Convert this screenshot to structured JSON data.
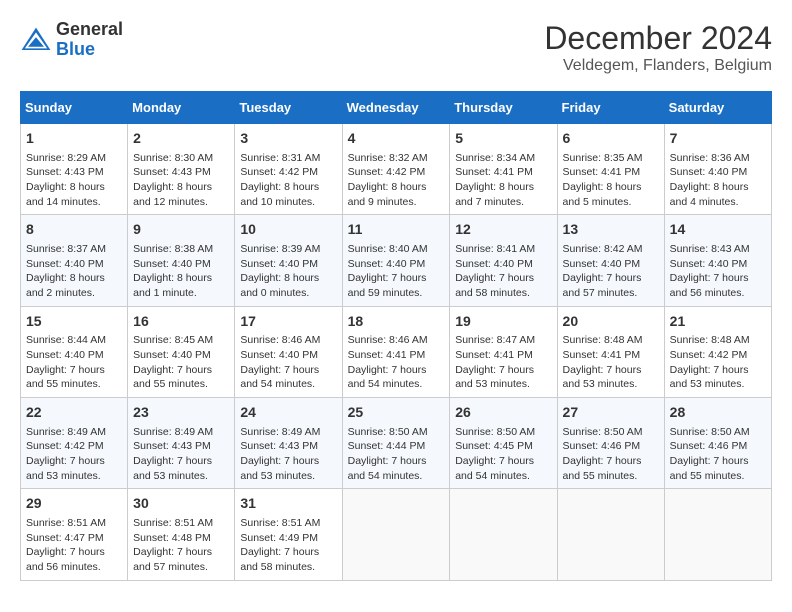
{
  "logo": {
    "text_general": "General",
    "text_blue": "Blue"
  },
  "title": "December 2024",
  "subtitle": "Veldegem, Flanders, Belgium",
  "days_of_week": [
    "Sunday",
    "Monday",
    "Tuesday",
    "Wednesday",
    "Thursday",
    "Friday",
    "Saturday"
  ],
  "weeks": [
    [
      {
        "day": "1",
        "info": "Sunrise: 8:29 AM\nSunset: 4:43 PM\nDaylight: 8 hours\nand 14 minutes."
      },
      {
        "day": "2",
        "info": "Sunrise: 8:30 AM\nSunset: 4:43 PM\nDaylight: 8 hours\nand 12 minutes."
      },
      {
        "day": "3",
        "info": "Sunrise: 8:31 AM\nSunset: 4:42 PM\nDaylight: 8 hours\nand 10 minutes."
      },
      {
        "day": "4",
        "info": "Sunrise: 8:32 AM\nSunset: 4:42 PM\nDaylight: 8 hours\nand 9 minutes."
      },
      {
        "day": "5",
        "info": "Sunrise: 8:34 AM\nSunset: 4:41 PM\nDaylight: 8 hours\nand 7 minutes."
      },
      {
        "day": "6",
        "info": "Sunrise: 8:35 AM\nSunset: 4:41 PM\nDaylight: 8 hours\nand 5 minutes."
      },
      {
        "day": "7",
        "info": "Sunrise: 8:36 AM\nSunset: 4:40 PM\nDaylight: 8 hours\nand 4 minutes."
      }
    ],
    [
      {
        "day": "8",
        "info": "Sunrise: 8:37 AM\nSunset: 4:40 PM\nDaylight: 8 hours\nand 2 minutes."
      },
      {
        "day": "9",
        "info": "Sunrise: 8:38 AM\nSunset: 4:40 PM\nDaylight: 8 hours\nand 1 minute."
      },
      {
        "day": "10",
        "info": "Sunrise: 8:39 AM\nSunset: 4:40 PM\nDaylight: 8 hours\nand 0 minutes."
      },
      {
        "day": "11",
        "info": "Sunrise: 8:40 AM\nSunset: 4:40 PM\nDaylight: 7 hours\nand 59 minutes."
      },
      {
        "day": "12",
        "info": "Sunrise: 8:41 AM\nSunset: 4:40 PM\nDaylight: 7 hours\nand 58 minutes."
      },
      {
        "day": "13",
        "info": "Sunrise: 8:42 AM\nSunset: 4:40 PM\nDaylight: 7 hours\nand 57 minutes."
      },
      {
        "day": "14",
        "info": "Sunrise: 8:43 AM\nSunset: 4:40 PM\nDaylight: 7 hours\nand 56 minutes."
      }
    ],
    [
      {
        "day": "15",
        "info": "Sunrise: 8:44 AM\nSunset: 4:40 PM\nDaylight: 7 hours\nand 55 minutes."
      },
      {
        "day": "16",
        "info": "Sunrise: 8:45 AM\nSunset: 4:40 PM\nDaylight: 7 hours\nand 55 minutes."
      },
      {
        "day": "17",
        "info": "Sunrise: 8:46 AM\nSunset: 4:40 PM\nDaylight: 7 hours\nand 54 minutes."
      },
      {
        "day": "18",
        "info": "Sunrise: 8:46 AM\nSunset: 4:41 PM\nDaylight: 7 hours\nand 54 minutes."
      },
      {
        "day": "19",
        "info": "Sunrise: 8:47 AM\nSunset: 4:41 PM\nDaylight: 7 hours\nand 53 minutes."
      },
      {
        "day": "20",
        "info": "Sunrise: 8:48 AM\nSunset: 4:41 PM\nDaylight: 7 hours\nand 53 minutes."
      },
      {
        "day": "21",
        "info": "Sunrise: 8:48 AM\nSunset: 4:42 PM\nDaylight: 7 hours\nand 53 minutes."
      }
    ],
    [
      {
        "day": "22",
        "info": "Sunrise: 8:49 AM\nSunset: 4:42 PM\nDaylight: 7 hours\nand 53 minutes."
      },
      {
        "day": "23",
        "info": "Sunrise: 8:49 AM\nSunset: 4:43 PM\nDaylight: 7 hours\nand 53 minutes."
      },
      {
        "day": "24",
        "info": "Sunrise: 8:49 AM\nSunset: 4:43 PM\nDaylight: 7 hours\nand 53 minutes."
      },
      {
        "day": "25",
        "info": "Sunrise: 8:50 AM\nSunset: 4:44 PM\nDaylight: 7 hours\nand 54 minutes."
      },
      {
        "day": "26",
        "info": "Sunrise: 8:50 AM\nSunset: 4:45 PM\nDaylight: 7 hours\nand 54 minutes."
      },
      {
        "day": "27",
        "info": "Sunrise: 8:50 AM\nSunset: 4:46 PM\nDaylight: 7 hours\nand 55 minutes."
      },
      {
        "day": "28",
        "info": "Sunrise: 8:50 AM\nSunset: 4:46 PM\nDaylight: 7 hours\nand 55 minutes."
      }
    ],
    [
      {
        "day": "29",
        "info": "Sunrise: 8:51 AM\nSunset: 4:47 PM\nDaylight: 7 hours\nand 56 minutes."
      },
      {
        "day": "30",
        "info": "Sunrise: 8:51 AM\nSunset: 4:48 PM\nDaylight: 7 hours\nand 57 minutes."
      },
      {
        "day": "31",
        "info": "Sunrise: 8:51 AM\nSunset: 4:49 PM\nDaylight: 7 hours\nand 58 minutes."
      },
      null,
      null,
      null,
      null
    ]
  ]
}
